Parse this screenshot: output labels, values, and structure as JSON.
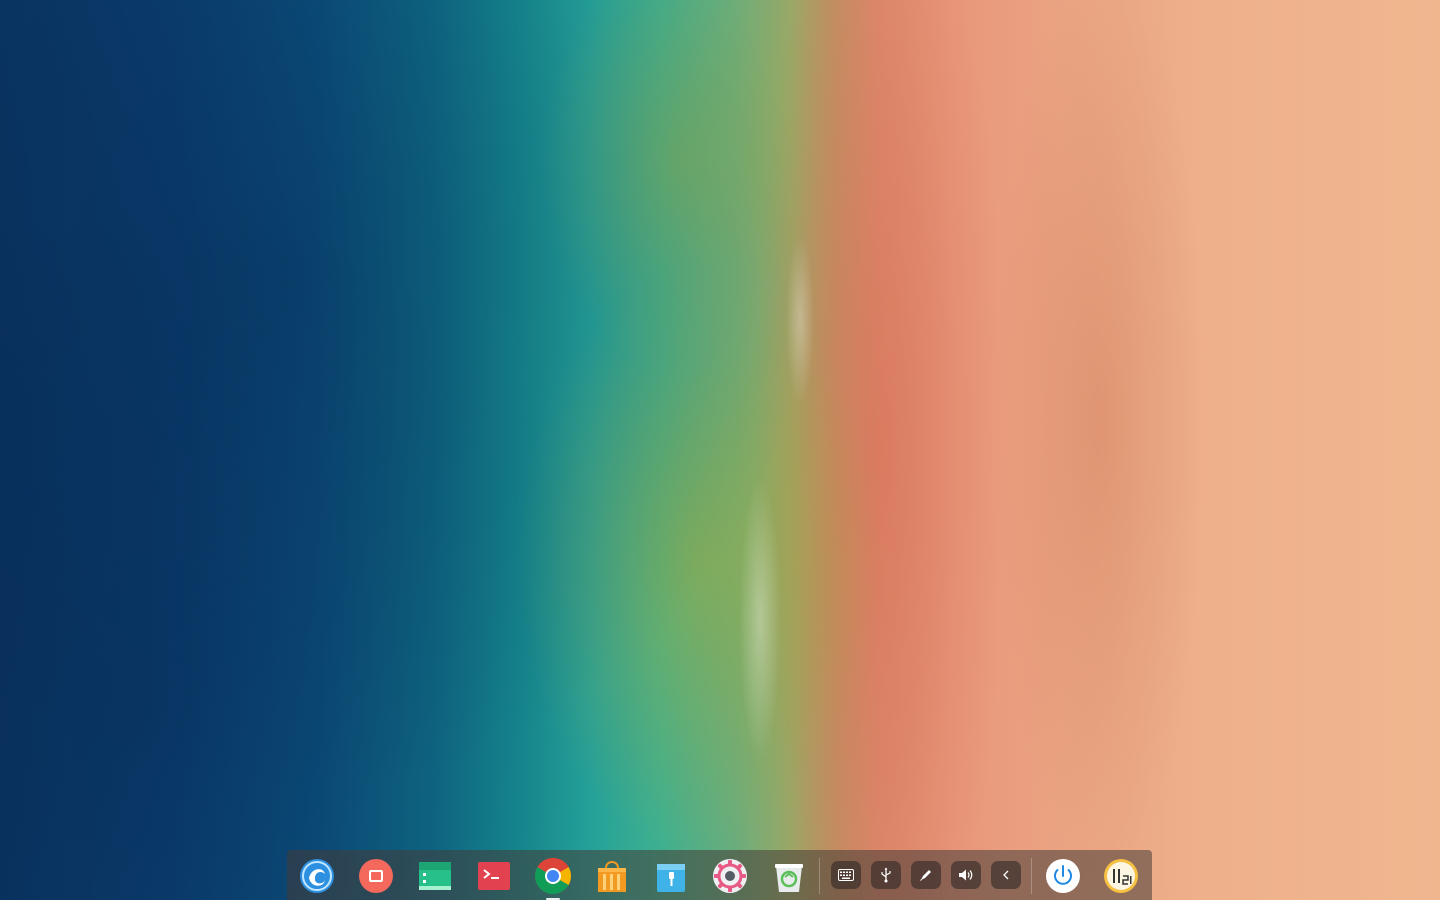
{
  "desktop": {
    "wallpaper": "aerial-beach-ocean"
  },
  "dock": {
    "apps": [
      {
        "name": "launcher",
        "icon": "deepin-launcher-icon",
        "active": false
      },
      {
        "name": "screen-recorder",
        "icon": "screen-recorder-icon",
        "active": false
      },
      {
        "name": "file-manager",
        "icon": "file-manager-icon",
        "active": false
      },
      {
        "name": "terminal",
        "icon": "terminal-icon",
        "active": false
      },
      {
        "name": "chrome",
        "icon": "chrome-icon",
        "active": true
      },
      {
        "name": "app-store",
        "icon": "app-store-icon",
        "active": false
      },
      {
        "name": "archive-manager",
        "icon": "archive-manager-icon",
        "active": false
      },
      {
        "name": "settings",
        "icon": "settings-gear-icon",
        "active": false
      },
      {
        "name": "trash",
        "icon": "trash-icon",
        "active": false
      }
    ],
    "tray": [
      {
        "name": "keyboard",
        "icon": "keyboard-icon"
      },
      {
        "name": "usb",
        "icon": "usb-icon"
      },
      {
        "name": "pen",
        "icon": "pen-icon"
      },
      {
        "name": "volume",
        "icon": "volume-icon"
      },
      {
        "name": "expand",
        "icon": "chevron-left-icon"
      }
    ],
    "power": {
      "icon": "power-icon"
    },
    "clock": {
      "icon": "analog-clock-icon"
    },
    "colors": {
      "dock_bg": "#463c37",
      "power_blue": "#1e88e5",
      "clock_yellow": "#f6c042"
    }
  }
}
